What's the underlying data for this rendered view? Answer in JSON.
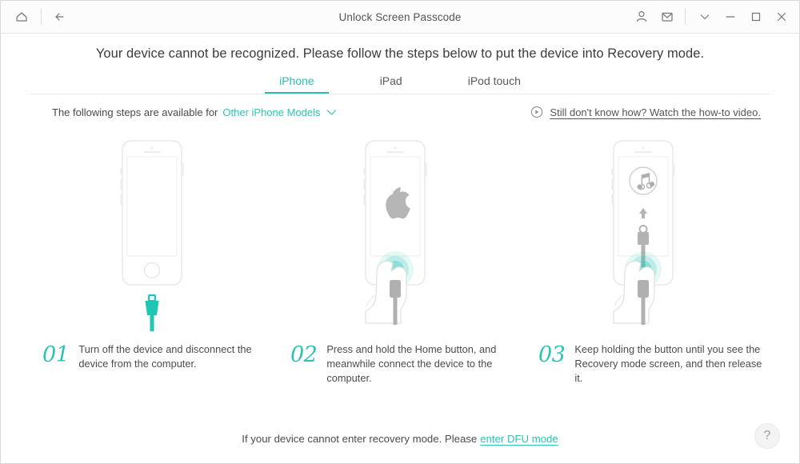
{
  "titlebar": {
    "title": "Unlock Screen Passcode",
    "home_icon": "home-icon",
    "back_icon": "back-arrow-icon",
    "account_icon": "user-account-icon",
    "mail_icon": "mail-envelope-icon",
    "more_icon": "chevron-down-icon",
    "minimize_icon": "minimize-icon",
    "maximize_icon": "maximize-icon",
    "close_icon": "close-icon"
  },
  "headline": "Your device cannot be recognized. Please follow the steps below to put the device into Recovery mode.",
  "tabs": [
    {
      "label": "iPhone",
      "active": true
    },
    {
      "label": "iPad",
      "active": false
    },
    {
      "label": "iPod touch",
      "active": false
    }
  ],
  "subbar": {
    "prefix": "The following steps are available for",
    "models_value": "Other iPhone Models",
    "video_link": "Still don't know how? Watch the how-to video.",
    "play_icon": "play-circle-icon"
  },
  "steps": [
    {
      "number": "01",
      "text": "Turn off the device and disconnect the device from the computer.",
      "art": "iphone-off-with-disconnected-cable"
    },
    {
      "number": "02",
      "text": "Press and hold the Home button, and meanwhile connect the device to the computer.",
      "art": "iphone-apple-logo-hand-pressing-home"
    },
    {
      "number": "03",
      "text": "Keep holding the button until you see the Recovery mode screen, and then release it.",
      "art": "iphone-recovery-screen-itunes-connect"
    }
  ],
  "footer": {
    "text": "If your device cannot enter recovery mode. Please",
    "link": "enter DFU mode",
    "help_label": "?"
  },
  "colors": {
    "accent": "#2fc3b1",
    "text": "#4c4c4c",
    "device_outline": "#e2e2e2",
    "cable_gray": "#a9a9a9"
  }
}
